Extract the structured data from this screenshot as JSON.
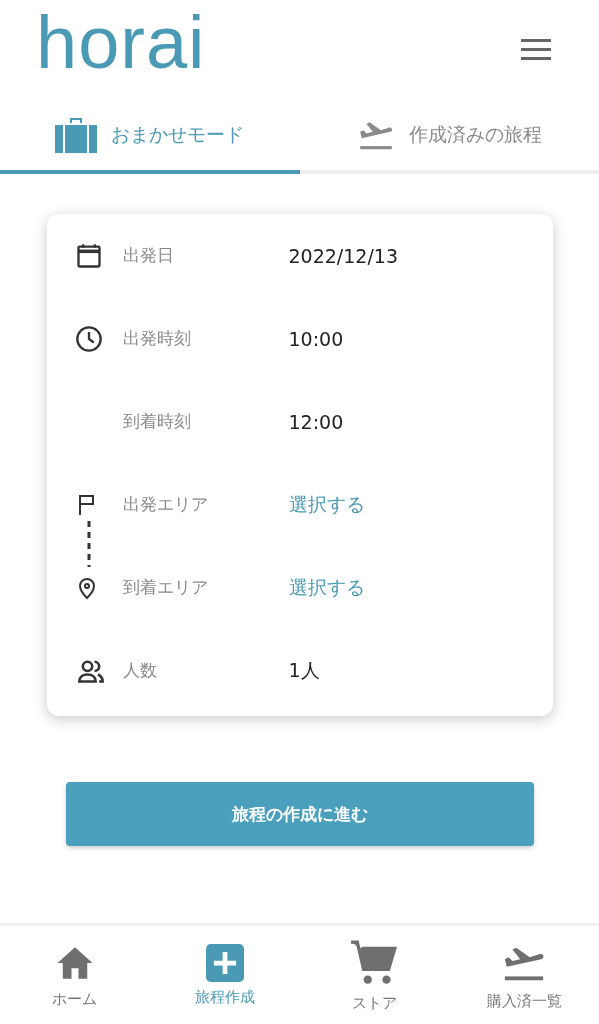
{
  "header": {
    "logo": "horai"
  },
  "tabs": [
    {
      "label": "おまかせモード",
      "selected": true
    },
    {
      "label": "作成済みの旅程",
      "selected": false
    }
  ],
  "form": {
    "rows": [
      {
        "label": "出発日",
        "value": "2022/12/13",
        "link": false
      },
      {
        "label": "出発時刻",
        "value": "10:00",
        "link": false
      },
      {
        "label": "到着時刻",
        "value": "12:00",
        "link": false
      },
      {
        "label": "出発エリア",
        "value": "選択する",
        "link": true
      },
      {
        "label": "到着エリア",
        "value": "選択する",
        "link": true
      },
      {
        "label": "人数",
        "value": "1人",
        "link": false
      }
    ]
  },
  "submit_button": "旅程の作成に進む",
  "bottom_nav": [
    {
      "label": "ホーム",
      "selected": false
    },
    {
      "label": "旅程作成",
      "selected": true
    },
    {
      "label": "ストア",
      "selected": false
    },
    {
      "label": "購入済一覧",
      "selected": false
    }
  ]
}
